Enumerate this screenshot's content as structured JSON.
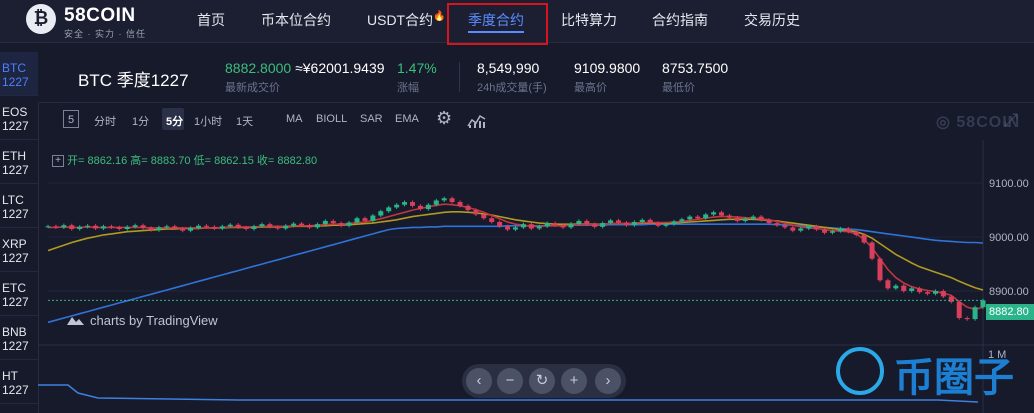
{
  "logo": {
    "mark": "₿",
    "name": "58COIN",
    "slogan": "安全 · 实力 · 信任"
  },
  "nav": {
    "items": [
      {
        "label": "首页"
      },
      {
        "label": "币本位合约"
      },
      {
        "label": "USDT合约"
      },
      {
        "label": "季度合约"
      },
      {
        "label": "比特算力"
      },
      {
        "label": "合约指南"
      },
      {
        "label": "交易历史"
      }
    ],
    "active_index": 3
  },
  "symbols": [
    {
      "name": "BTC",
      "code": "1227"
    },
    {
      "name": "EOS",
      "code": "1227"
    },
    {
      "name": "ETH",
      "code": "1227"
    },
    {
      "name": "LTC",
      "code": "1227"
    },
    {
      "name": "XRP",
      "code": "1227"
    },
    {
      "name": "ETC",
      "code": "1227"
    },
    {
      "name": "BNB",
      "code": "1227"
    },
    {
      "name": "HT",
      "code": "1227"
    }
  ],
  "ticker": {
    "pair": "BTC 季度1227",
    "last_price": "8882.8000",
    "last_price_cny": "≈¥62001.9439",
    "last_price_label": "最新成交价",
    "change": "1.47%",
    "change_label": "涨幅",
    "volume": "8,549,990",
    "volume_label": "24h成交量(手)",
    "high": "9109.9800",
    "high_label": "最高价",
    "low": "8753.7500",
    "low_label": "最低价"
  },
  "toolbar": {
    "interval_box": "5",
    "items": [
      "分时",
      "1分",
      "5分",
      "1小时",
      "1天",
      "MA",
      "BIOLL",
      "SAR",
      "EMA"
    ],
    "active_interval": "5分",
    "settings_icon": "gear-icon",
    "indicators_icon": "chart-indicator-icon",
    "tv_logo": "58COIN",
    "fullscreen_icon": "fullscreen-icon"
  },
  "chart": {
    "ohlc_box": "+",
    "ohlc": "开= 8862.16 高= 8883.70 低= 8862.15 收= 8882.80",
    "tradingview_credit": "charts by TradingView",
    "price_tag": "8882.80",
    "volume_axis_label": "1 M",
    "zoom_controls": [
      "‹",
      "−",
      "↻",
      "+",
      "›"
    ]
  },
  "watermark": {
    "text": "币圈子"
  },
  "chart_data": {
    "type": "candlestick",
    "y_ticks": [
      9100,
      9000,
      8900
    ],
    "ylim": [
      8800,
      9180
    ],
    "last_price": 8882.8,
    "close": [
      9020,
      9018,
      9022,
      9015,
      9019,
      9021,
      9016,
      9020,
      9018,
      9015,
      9019,
      9022,
      9017,
      9013,
      9018,
      9020,
      9016,
      9012,
      9017,
      9021,
      9019,
      9016,
      9020,
      9023,
      9018,
      9015,
      9020,
      9024,
      9019,
      9016,
      9021,
      9025,
      9022,
      9018,
      9024,
      9030,
      9026,
      9021,
      9027,
      9035,
      9030,
      9040,
      9048,
      9055,
      9060,
      9065,
      9058,
      9052,
      9060,
      9068,
      9072,
      9065,
      9058,
      9050,
      9042,
      9035,
      9028,
      9020,
      9014,
      9018,
      9024,
      9016,
      9020,
      9026,
      9022,
      9018,
      9025,
      9030,
      9024,
      9019,
      9026,
      9031,
      9027,
      9022,
      9028,
      9032,
      9026,
      9021,
      9024,
      9029,
      9033,
      9038,
      9035,
      9042,
      9046,
      9040,
      9036,
      9030,
      9034,
      9038,
      9032,
      9026,
      9022,
      9018,
      9012,
      9016,
      9020,
      9014,
      9008,
      9011,
      9016,
      9010,
      9004,
      8990,
      8960,
      8920,
      8905,
      8910,
      8900,
      8905,
      8898,
      8895,
      8900,
      8890,
      8880,
      8850,
      8848,
      8870,
      8882.8
    ],
    "ma_short": [
      9018,
      9018,
      9019,
      9018,
      9018,
      9019,
      9018,
      9018,
      9018,
      9018,
      9018,
      9018,
      9018,
      9017,
      9017,
      9017,
      9017,
      9017,
      9017,
      9017,
      9017,
      9017,
      9018,
      9019,
      9019,
      9019,
      9019,
      9020,
      9020,
      9020,
      9020,
      9021,
      9021,
      9021,
      9022,
      9023,
      9024,
      9024,
      9025,
      9027,
      9028,
      9031,
      9034,
      9038,
      9042,
      9046,
      9050,
      9053,
      9056,
      9059,
      9061,
      9060,
      9058,
      9055,
      9051,
      9046,
      9040,
      9034,
      9028,
      9024,
      9022,
      9020,
      9020,
      9021,
      9021,
      9021,
      9022,
      9023,
      9023,
      9023,
      9024,
      9025,
      9025,
      9025,
      9026,
      9027,
      9027,
      9027,
      9027,
      9028,
      9029,
      9031,
      9033,
      9035,
      9037,
      9038,
      9038,
      9037,
      9036,
      9035,
      9034,
      9032,
      9029,
      9026,
      9022,
      9019,
      9017,
      9016,
      9014,
      9012,
      9011,
      9010,
      9006,
      8996,
      8980,
      8960,
      8940,
      8925,
      8915,
      8908,
      8904,
      8901,
      8899,
      8896,
      8892,
      8880,
      8870,
      8866,
      8870
    ],
    "ma_mid": [
      8975,
      8980,
      8985,
      8990,
      8994,
      8998,
      9001,
      9004,
      9006,
      9008,
      9010,
      9011,
      9012,
      9013,
      9014,
      9015,
      9015,
      9016,
      9016,
      9016,
      9017,
      9017,
      9017,
      9018,
      9018,
      9018,
      9018,
      9019,
      9019,
      9019,
      9019,
      9020,
      9020,
      9020,
      9021,
      9021,
      9022,
      9022,
      9023,
      9024,
      9025,
      9026,
      9028,
      9030,
      9032,
      9035,
      9038,
      9040,
      9042,
      9044,
      9046,
      9047,
      9047,
      9046,
      9045,
      9043,
      9041,
      9038,
      9035,
      9032,
      9030,
      9028,
      9026,
      9025,
      9024,
      9024,
      9024,
      9024,
      9024,
      9024,
      9024,
      9025,
      9025,
      9025,
      9025,
      9026,
      9026,
      9026,
      9026,
      9026,
      9027,
      9028,
      9029,
      9030,
      9031,
      9032,
      9033,
      9033,
      9033,
      9033,
      9032,
      9031,
      9030,
      9028,
      9026,
      9024,
      9022,
      9020,
      9018,
      9016,
      9014,
      9012,
      9010,
      9005,
      8998,
      8988,
      8978,
      8968,
      8960,
      8952,
      8945,
      8940,
      8935,
      8930,
      8925,
      8918,
      8912,
      8906,
      8902
    ],
    "ma_long": [
      8842,
      8846,
      8850,
      8854,
      8858,
      8862,
      8866,
      8870,
      8874,
      8878,
      8882,
      8886,
      8890,
      8894,
      8898,
      8902,
      8906,
      8910,
      8914,
      8918,
      8922,
      8926,
      8930,
      8934,
      8938,
      8942,
      8946,
      8950,
      8954,
      8958,
      8962,
      8966,
      8970,
      8974,
      8978,
      8982,
      8986,
      8990,
      8994,
      8998,
      9002,
      9006,
      9010,
      9014,
      9016,
      9017,
      9018,
      9018,
      9019,
      9019,
      9020,
      9020,
      9020,
      9020,
      9020,
      9020,
      9020,
      9020,
      9021,
      9021,
      9021,
      9021,
      9021,
      9021,
      9021,
      9022,
      9022,
      9022,
      9022,
      9022,
      9022,
      9023,
      9023,
      9023,
      9023,
      9023,
      9024,
      9024,
      9024,
      9024,
      9024,
      9024,
      9024,
      9024,
      9024,
      9024,
      9024,
      9024,
      9024,
      9024,
      9024,
      9024,
      9023,
      9023,
      9022,
      9021,
      9020,
      9019,
      9018,
      9017,
      9016,
      9015,
      9014,
      9012,
      9010,
      9008,
      9006,
      9004,
      9002,
      9000,
      8998,
      8996,
      8994,
      8993,
      8992,
      8991,
      8990,
      8990,
      8989
    ]
  }
}
